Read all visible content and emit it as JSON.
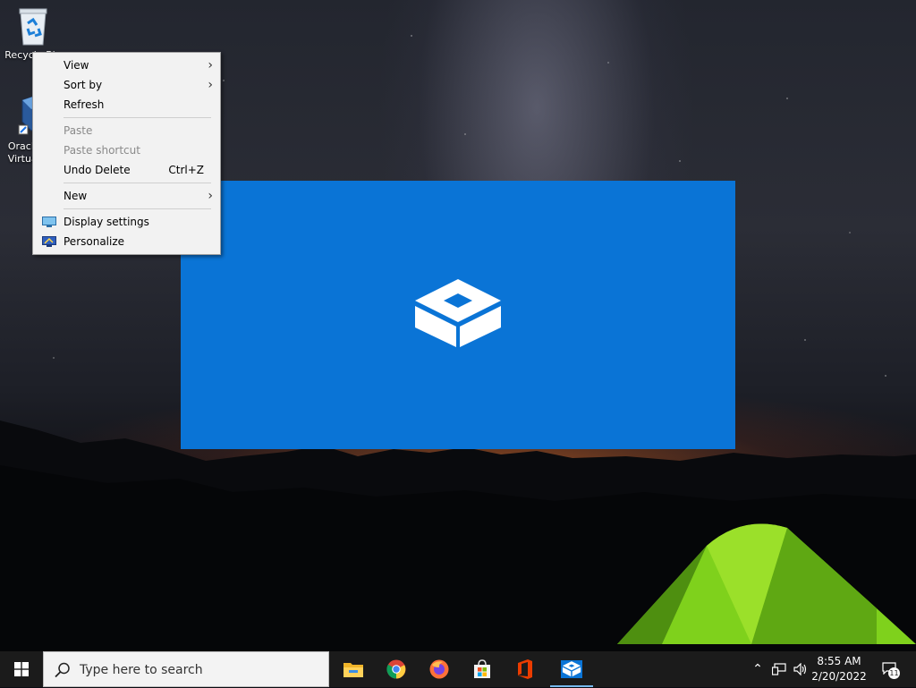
{
  "desktop": {
    "icons": [
      {
        "label": "Recycle Bin",
        "icon": "recycle-bin-icon"
      },
      {
        "label": "Oracle VM VirtualBox",
        "icon": "virtualbox-icon"
      }
    ]
  },
  "context_menu": {
    "items": [
      {
        "label": "View",
        "submenu": true,
        "enabled": true
      },
      {
        "label": "Sort by",
        "submenu": true,
        "enabled": true
      },
      {
        "label": "Refresh",
        "enabled": true
      },
      {
        "label": "Paste",
        "enabled": false
      },
      {
        "label": "Paste shortcut",
        "enabled": false
      },
      {
        "label": "Undo Delete",
        "shortcut": "Ctrl+Z",
        "enabled": true
      },
      {
        "label": "New",
        "submenu": true,
        "enabled": true
      },
      {
        "label": "Display settings",
        "icon": "display-settings-icon",
        "enabled": true
      },
      {
        "label": "Personalize",
        "icon": "personalize-icon",
        "enabled": true
      }
    ]
  },
  "splash": {
    "app": "Windows Sandbox",
    "icon": "sandbox-icon",
    "background": "#0a74d6"
  },
  "taskbar": {
    "search_placeholder": "Type here to search",
    "apps": [
      {
        "name": "File Explorer",
        "icon": "folder-icon"
      },
      {
        "name": "Google Chrome",
        "icon": "chrome-icon"
      },
      {
        "name": "Firefox",
        "icon": "firefox-icon"
      },
      {
        "name": "Microsoft Store",
        "icon": "store-icon"
      },
      {
        "name": "Office",
        "icon": "office-icon"
      },
      {
        "name": "Windows Sandbox",
        "icon": "sandbox-icon",
        "active": true
      }
    ],
    "clock": {
      "time": "8:55 AM",
      "date": "2/20/2022"
    },
    "notifications_count": "11"
  }
}
